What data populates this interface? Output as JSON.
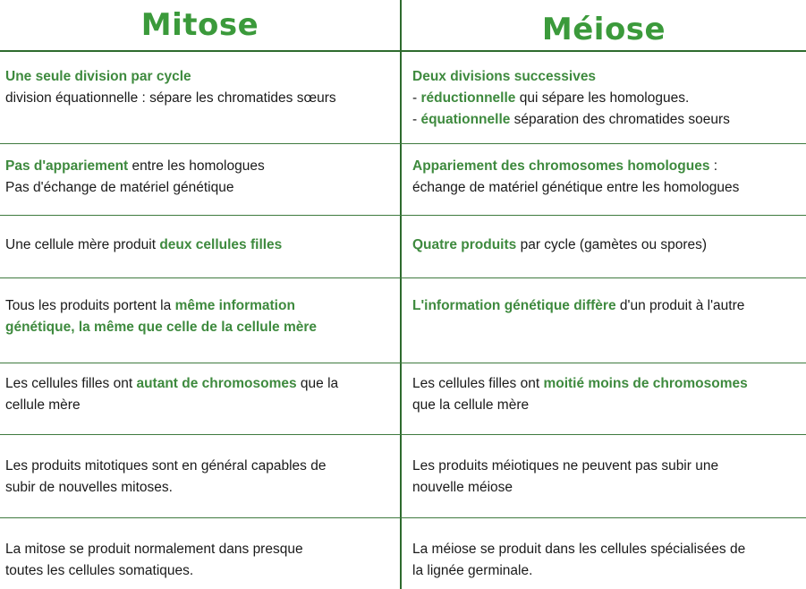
{
  "headers": {
    "left": "Mitose",
    "right": "Méiose"
  },
  "colors": {
    "accent": "#3e8a3e",
    "rule": "#2e6b2e"
  },
  "rows": [
    {
      "left": [
        [
          {
            "t": "Une seule division par cycle",
            "h": true
          }
        ],
        [
          {
            "t": "division équationnelle : sépare les chromatides sœurs",
            "h": false
          }
        ]
      ],
      "right": [
        [
          {
            "t": "Deux divisions successives",
            "h": true
          }
        ],
        [
          {
            "t": "- ",
            "h": false
          },
          {
            "t": "réductionnelle",
            "h": true
          },
          {
            "t": " qui sépare les homologues.",
            "h": false
          }
        ],
        [
          {
            "t": "- ",
            "h": false
          },
          {
            "t": "équationnelle",
            "h": true
          },
          {
            "t": " séparation des chromatides soeurs",
            "h": false
          }
        ]
      ]
    },
    {
      "left": [
        [
          {
            "t": "Pas d'appariement",
            "h": true
          },
          {
            "t": " entre les homologues",
            "h": false
          }
        ],
        [
          {
            "t": "Pas d'échange de matériel génétique",
            "h": false
          }
        ]
      ],
      "right": [
        [
          {
            "t": "Appariement des chromosomes homologues",
            "h": true
          },
          {
            "t": " :",
            "h": false
          }
        ],
        [
          {
            "t": "échange de matériel génétique entre les homologues",
            "h": false
          }
        ]
      ]
    },
    {
      "left": [
        [
          {
            "t": "Une cellule mère produit ",
            "h": false
          },
          {
            "t": "deux cellules filles",
            "h": true
          }
        ]
      ],
      "right": [
        [
          {
            "t": "Quatre produits",
            "h": true
          },
          {
            "t": " par cycle (gamètes ou spores)",
            "h": false
          }
        ]
      ]
    },
    {
      "left": [
        [
          {
            "t": "Tous les produits portent la ",
            "h": false
          },
          {
            "t": "même information",
            "h": true
          }
        ],
        [
          {
            "t": "génétique, la même que celle de la cellule mère",
            "h": true
          }
        ]
      ],
      "right": [
        [
          {
            "t": "L'information génétique diffère",
            "h": true
          },
          {
            "t": " d'un produit à l'autre",
            "h": false
          }
        ]
      ]
    },
    {
      "left": [
        [
          {
            "t": "Les cellules filles ont ",
            "h": false
          },
          {
            "t": "autant de chromosomes",
            "h": true
          },
          {
            "t": " que la",
            "h": false
          }
        ],
        [
          {
            "t": "cellule mère",
            "h": false
          }
        ]
      ],
      "right": [
        [
          {
            "t": "Les cellules filles ont ",
            "h": false
          },
          {
            "t": "moitié moins de chromosomes",
            "h": true
          }
        ],
        [
          {
            "t": "que la cellule mère",
            "h": false
          }
        ]
      ]
    },
    {
      "left": [
        [
          {
            "t": "Les produits mitotiques sont en général capables de",
            "h": false
          }
        ],
        [
          {
            "t": "subir de nouvelles mitoses.",
            "h": false
          }
        ]
      ],
      "right": [
        [
          {
            "t": "Les produits méiotiques ne peuvent pas subir une",
            "h": false
          }
        ],
        [
          {
            "t": "nouvelle méiose",
            "h": false
          }
        ]
      ]
    },
    {
      "left": [
        [
          {
            "t": "La mitose se produit normalement dans presque",
            "h": false
          }
        ],
        [
          {
            "t": "toutes les cellules somatiques.",
            "h": false
          }
        ]
      ],
      "right": [
        [
          {
            "t": "La méiose se produit dans les cellules spécialisées de",
            "h": false
          }
        ],
        [
          {
            "t": "la lignée germinale.",
            "h": false
          }
        ]
      ]
    }
  ]
}
